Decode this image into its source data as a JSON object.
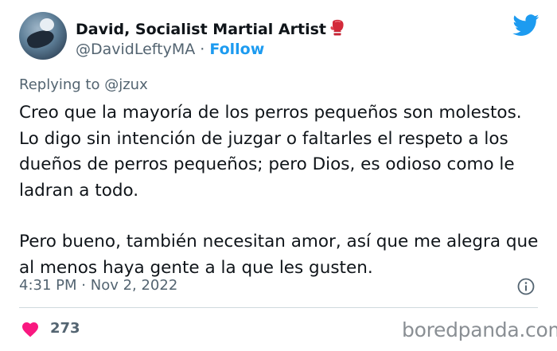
{
  "author": {
    "display_name": "David, Socialist Martial Artist",
    "handle": "@DavidLeftyMA",
    "separator": "·",
    "follow_label": "Follow",
    "name_emoji": "boxing-glove-icon"
  },
  "reply": {
    "prefix": "Replying to",
    "mention": "@jzux"
  },
  "tweet": {
    "paragraph1": "Creo que la mayoría de los perros pequeños son molestos. Lo digo sin intención de juzgar o faltarles el respeto a los dueños de perros pequeños; pero Dios, es odioso como le ladran a todo.",
    "paragraph2": "Pero bueno, también necesitan amor, así que me alegra que al menos haya gente a la que les gusten."
  },
  "meta": {
    "time": "4:31 PM",
    "separator": "·",
    "date": "Nov 2, 2022"
  },
  "stats": {
    "likes": "273"
  },
  "watermark": "boredpanda.com",
  "colors": {
    "accent": "#1d9bf0",
    "heart": "#f91880",
    "muted": "#536471",
    "text": "#0f1419"
  }
}
